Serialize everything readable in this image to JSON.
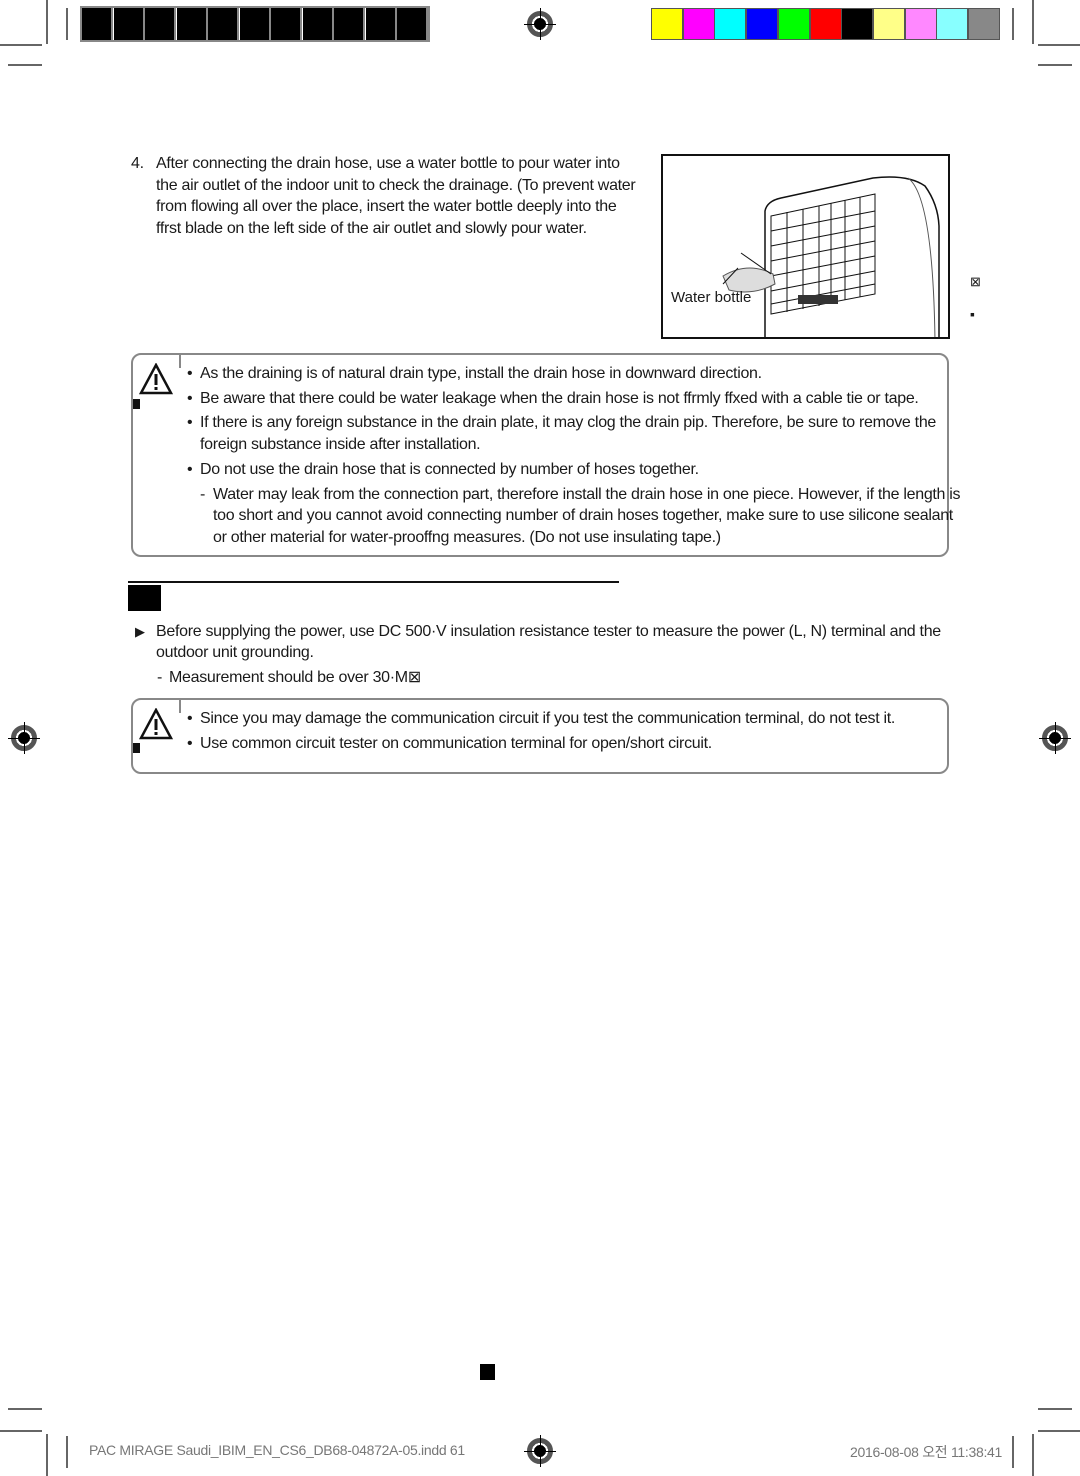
{
  "print_marks": {
    "color_bar": [
      "#ffff00",
      "#ff00ff",
      "#00ffff",
      "#0000ff",
      "#00ff00",
      "#ff0000",
      "#000000",
      "#ffff88",
      "#ff88ff",
      "#88ffff",
      "#888888"
    ]
  },
  "step4": {
    "number": "4.",
    "lines": [
      "After connecting the drain hose, use a water bottle to pour water into",
      "the air outlet of the indoor unit to check the drainage. (To prevent water",
      "from flowing all over the place, insert the water bottle deeply into the",
      "ffrst blade on the left side of the air outlet and slowly pour water."
    ],
    "figure_label": "Water bottle",
    "side_glyphs": [
      "⊠",
      "▪"
    ]
  },
  "caution1": {
    "bullets": [
      [
        "As the draining is of natural drain type, install the drain hose in downward direction."
      ],
      [
        "Be aware that there could be water leakage when the drain hose is not ffrmly ffxed with a cable tie or tape."
      ],
      [
        "If there is any foreign substance in the drain plate, it may clog the drain pip. Therefore, be sure to remove the",
        "foreign substance inside after installation."
      ],
      [
        "Do not use the drain hose that is connected by number of hoses together."
      ]
    ],
    "sub": [
      "Water may leak from the connection part, therefore install the drain hose in one piece. However, if the length is",
      "too short and you cannot avoid connecting number of drain hoses together, make sure to use silicone sealant",
      "or other material for water-prooffng measures. (Do not use insulating tape.)"
    ]
  },
  "section": {
    "lines": [
      "Before supplying the power, use DC 500·V insulation resistance tester to measure the power (L, N) terminal and the",
      "outdoor unit grounding."
    ],
    "sub": "Measurement should be over 30·M⊠"
  },
  "caution2": {
    "bullets": [
      "Since you may damage the communication circuit if you test the communication terminal, do not test it.",
      "Use common circuit tester on communication terminal for open/short circuit."
    ]
  },
  "footer": {
    "file": "PAC MIRAGE Saudi_IBIM_EN_CS6_DB68-04872A-05.indd   61",
    "timestamp": "2016-08-08   오전 11:38:41"
  }
}
